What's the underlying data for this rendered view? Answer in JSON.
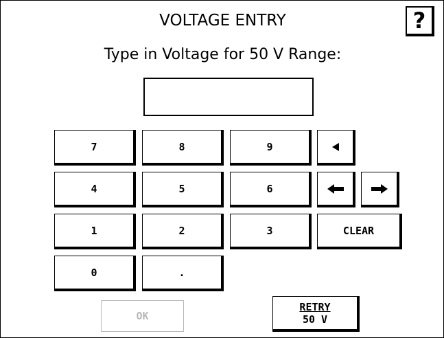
{
  "header": {
    "title": "VOLTAGE ENTRY",
    "help_label": "?",
    "prompt": "Type in Voltage for 50 V Range:"
  },
  "entry": {
    "value": ""
  },
  "keypad": {
    "k7": "7",
    "k8": "8",
    "k9": "9",
    "k4": "4",
    "k5": "5",
    "k6": "6",
    "k1": "1",
    "k2": "2",
    "k3": "3",
    "k0": "0",
    "dot": ".",
    "clear": "CLEAR",
    "backspace_icon": "backspace-triangle-icon",
    "left_icon": "left-arrow-icon",
    "right_icon": "right-arrow-icon"
  },
  "actions": {
    "ok": "OK",
    "ok_enabled": false,
    "retry_line1": "RETRY",
    "retry_line2": "50 V"
  },
  "colors": {
    "disabled": "#b8b8b8",
    "foreground": "#000000",
    "background": "#ffffff"
  }
}
